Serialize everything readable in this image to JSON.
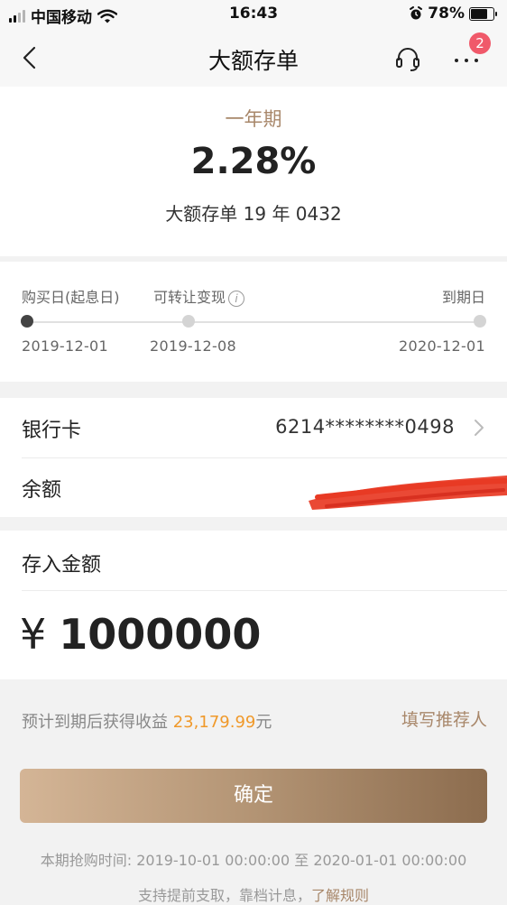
{
  "status_bar": {
    "carrier": "中国移动",
    "time": "16:43",
    "battery": "78%",
    "battery_level": 0.78
  },
  "nav": {
    "title": "大额存单",
    "badge_count": "2"
  },
  "product": {
    "term": "一年期",
    "rate": "2.28%",
    "name": "大额存单 19 年 0432"
  },
  "timeline": {
    "purchase_label": "购买日(起息日)",
    "transfer_label": "可转让变现",
    "maturity_label": "到期日",
    "purchase_date": "2019-12-01",
    "transfer_date": "2019-12-08",
    "maturity_date": "2020-12-01"
  },
  "account": {
    "card_label": "银行卡",
    "card_number": "6214********0498",
    "balance_label": "余额"
  },
  "deposit": {
    "label": "存入金额",
    "currency": "¥",
    "amount": "1000000"
  },
  "income": {
    "prefix": "预计到期后获得收益",
    "value": "23,179.99",
    "unit": "元",
    "referrer_link": "填写推荐人"
  },
  "confirm_label": "确定",
  "footer": {
    "period_text": "本期抢购时间: 2019-10-01 00:00:00 至 2020-01-01 00:00:00",
    "rules_text": "支持提前支取，靠档计息，",
    "rules_link": "了解规则"
  },
  "colors": {
    "gold": "#a8876a",
    "highlight": "#f0992a",
    "badge": "#f0596a",
    "redaction": "#e83a24"
  }
}
